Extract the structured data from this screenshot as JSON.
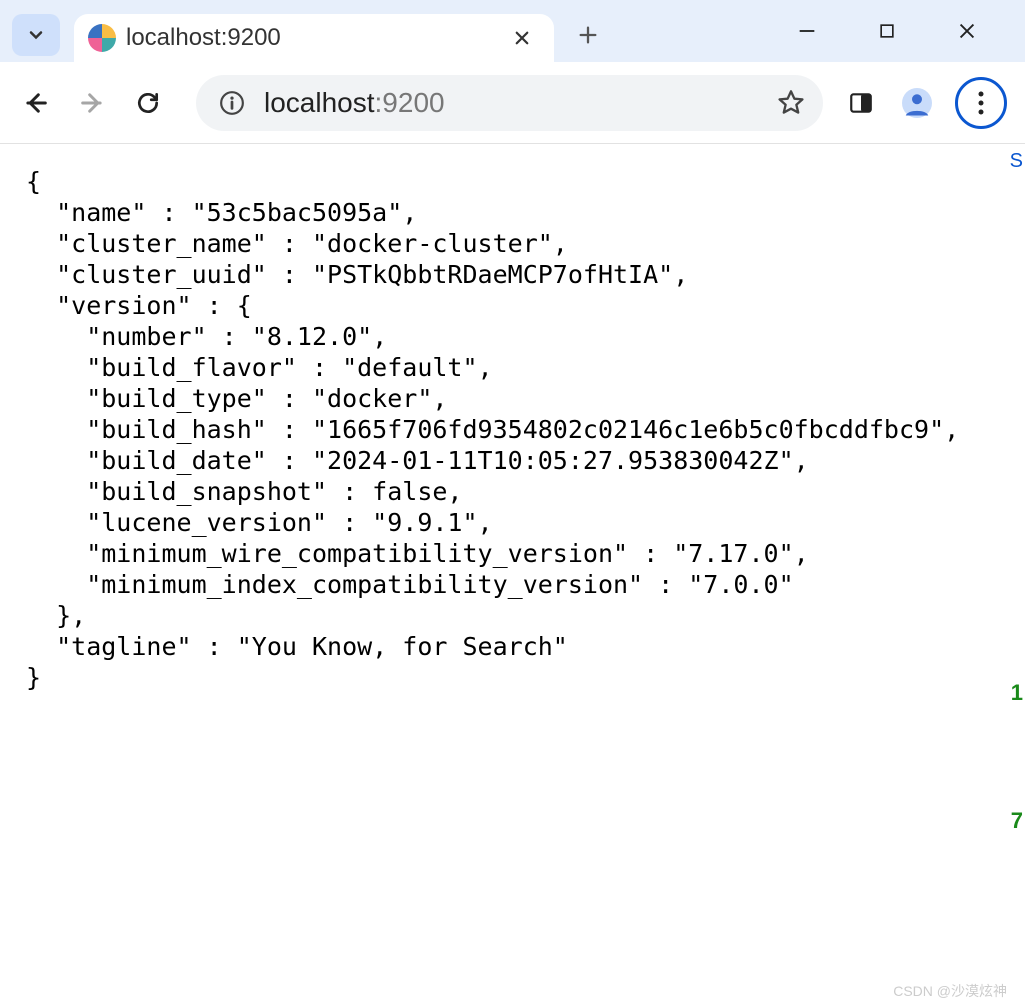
{
  "tab": {
    "title": "localhost:9200"
  },
  "address": {
    "host": "localhost",
    "port": ":9200"
  },
  "json_text": "{\n  \"name\" : \"53c5bac5095a\",\n  \"cluster_name\" : \"docker-cluster\",\n  \"cluster_uuid\" : \"PSTkQbbtRDaeMCP7ofHtIA\",\n  \"version\" : {\n    \"number\" : \"8.12.0\",\n    \"build_flavor\" : \"default\",\n    \"build_type\" : \"docker\",\n    \"build_hash\" : \"1665f706fd9354802c02146c1e6b5c0fbcddfbc9\",\n    \"build_date\" : \"2024-01-11T10:05:27.953830042Z\",\n    \"build_snapshot\" : false,\n    \"lucene_version\" : \"9.9.1\",\n    \"minimum_wire_compatibility_version\" : \"7.17.0\",\n    \"minimum_index_compatibility_version\" : \"7.0.0\"\n  },\n  \"tagline\" : \"You Know, for Search\"\n}",
  "watermark": "CSDN @沙漠炫神",
  "bleed": {
    "right_top": "S",
    "right_green1": "1",
    "right_green2": "7"
  }
}
